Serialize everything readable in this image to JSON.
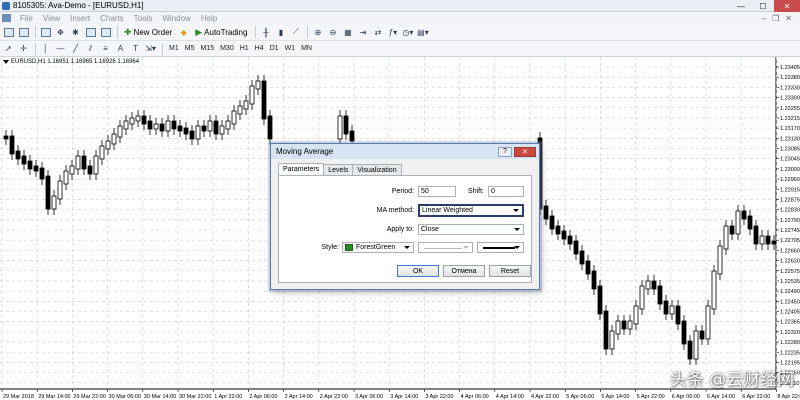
{
  "window": {
    "title": "8105305: Ava-Demo - [EURUSD,H1]"
  },
  "menu": {
    "items": [
      "File",
      "View",
      "Insert",
      "Charts",
      "Tools",
      "Window",
      "Help"
    ]
  },
  "toolbar": {
    "new_order": "New Order",
    "auto_trading": "AutoTrading"
  },
  "timeframes": [
    "M1",
    "M5",
    "M15",
    "M30",
    "H1",
    "H4",
    "D1",
    "W1",
    "MN"
  ],
  "chart": {
    "symbol_info": "EURUSD,H1  1.16951 1.16965 1.16926 1.16964",
    "price_labels": [
      "1.23405",
      "1.23380",
      "1.23330",
      "1.23300",
      "1.23255",
      "1.23215",
      "1.23170",
      "1.23130",
      "1.23085",
      "1.23045",
      "1.23000",
      "1.22960",
      "1.22915",
      "1.22875",
      "1.22830",
      "1.22790",
      "1.22745",
      "1.22705",
      "1.22660",
      "1.22620",
      "1.22575",
      "1.22535",
      "1.22490",
      "1.22450",
      "1.22405",
      "1.22365",
      "1.22320",
      "1.22280",
      "1.22235",
      "1.22195",
      "1.22150",
      "1.22110"
    ],
    "time_labels": [
      "29 Mar 2018",
      "29 Mar 14:00",
      "29 Mar 22:00",
      "30 Mar 06:00",
      "30 Mar 14:00",
      "30 Mar 22:00",
      "1 Apr 22:00",
      "2 Apr 06:00",
      "2 Apr 14:00",
      "2 Apr 22:00",
      "3 Apr 06:00",
      "3 Apr 14:00",
      "3 Apr 22:00",
      "4 Apr 06:00",
      "4 Apr 14:00",
      "4 Apr 22:00",
      "5 Apr 06:00",
      "5 Apr 14:00",
      "5 Apr 22:00",
      "6 Apr 06:00",
      "6 Apr 14:00",
      "6 Apr 22:00",
      "8 Apr 22:00"
    ]
  },
  "dialog": {
    "title": "Moving Average",
    "help_button": "?",
    "close_button": "✕",
    "tabs": [
      "Parameters",
      "Levels",
      "Visualization"
    ],
    "period_label": "Period:",
    "period_value": "50",
    "shift_label": "Shift:",
    "shift_value": "0",
    "ma_method_label": "MA method:",
    "ma_method_value": "Linear Weighted",
    "apply_to_label": "Apply to:",
    "apply_to_value": "Close",
    "style_label": "Style:",
    "color_value": "ForestGreen",
    "color_hex": "#228b22",
    "ok_button": "OK",
    "cancel_button": "Отмена",
    "reset_button": "Reset"
  },
  "watermark": {
    "text": "头条 @云财经网"
  }
}
